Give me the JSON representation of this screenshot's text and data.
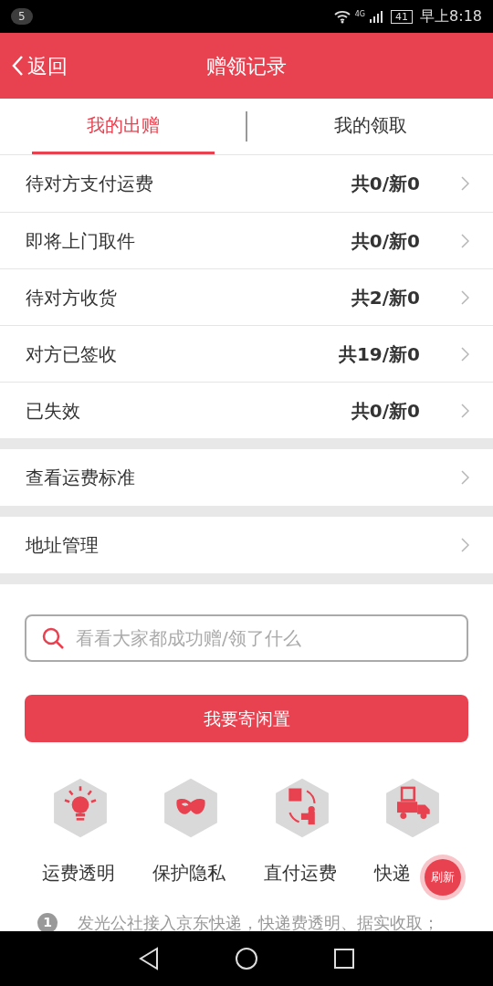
{
  "status_bar": {
    "notification_count": "5",
    "network": "4G",
    "battery": "41",
    "time": "早上8:18"
  },
  "header": {
    "back": "返回",
    "title": "赠领记录"
  },
  "tabs": [
    {
      "label": "我的出赠",
      "selected": true
    },
    {
      "label": "我的领取",
      "selected": false
    }
  ],
  "sections": [
    {
      "rows": [
        {
          "label": "待对方支付运费",
          "count": "共0/新0"
        },
        {
          "label": "即将上门取件",
          "count": "共0/新0"
        },
        {
          "label": "待对方收货",
          "count": "共2/新0"
        },
        {
          "label": "对方已签收",
          "count": "共19/新0"
        },
        {
          "label": "已失效",
          "count": "共0/新0"
        }
      ]
    },
    {
      "rows": [
        {
          "label": "查看运费标准"
        }
      ]
    },
    {
      "rows": [
        {
          "label": "地址管理"
        }
      ]
    }
  ],
  "search": {
    "placeholder": "看看大家都成功赠/领了什么"
  },
  "primary_button": "我要寄闲置",
  "features": [
    {
      "kind": "bulb",
      "label": "运费透明"
    },
    {
      "kind": "mask",
      "label": "保护隐私"
    },
    {
      "kind": "exchange",
      "label": "直付运费"
    },
    {
      "kind": "truck",
      "label": "快递"
    }
  ],
  "tips": [
    {
      "number": "1",
      "text": "发光公社接入京东快递，快递费透明、据实收取；"
    }
  ],
  "refresh_button": "刷新"
}
